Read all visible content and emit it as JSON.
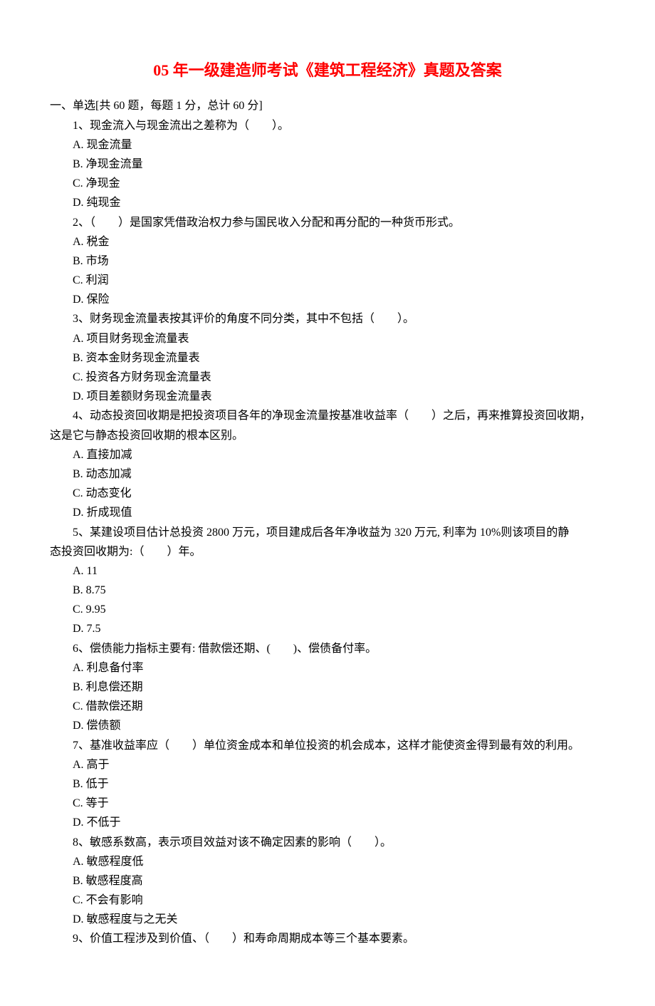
{
  "title": "05 年一级建造师考试《建筑工程经济》真题及答案",
  "section_header": "一、单选[共 60 题，每题 1 分，总计 60 分]",
  "questions": [
    {
      "text": "1、现金流入与现金流出之差称为（　　）。",
      "options": {
        "a": "A. 现金流量",
        "b": "B. 净现金流量",
        "c": "C. 净现金",
        "d": "D. 纯现金"
      }
    },
    {
      "text": "2、（　　）是国家凭借政治权力参与国民收入分配和再分配的一种货币形式。",
      "options": {
        "a": "A. 税金",
        "b": "B. 市场",
        "c": "C. 利润",
        "d": "D. 保险"
      }
    },
    {
      "text": "3、财务现金流量表按其评价的角度不同分类，其中不包括（　　）。",
      "options": {
        "a": "A. 项目财务现金流量表",
        "b": "B. 资本金财务现金流量表",
        "c": "C. 投资各方财务现金流量表",
        "d": "D. 项目差额财务现金流量表"
      }
    },
    {
      "text": "4、动态投资回收期是把投资项目各年的净现金流量按基准收益率（　　）之后，再来推算投资回收期，",
      "continuation": "这是它与静态投资回收期的根本区别。",
      "options": {
        "a": "A. 直接加减",
        "b": "B. 动态加减",
        "c": "C. 动态变化",
        "d": "D. 折成现值"
      }
    },
    {
      "text": "5、某建设项目估计总投资 2800 万元，项目建成后各年净收益为 320 万元, 利率为 10%则该项目的静",
      "continuation": "态投资回收期为:（　　）年。",
      "options": {
        "a": "A. 11",
        "b": "B. 8.75",
        "c": "C. 9.95",
        "d": "D. 7.5"
      }
    },
    {
      "text": "6、偿债能力指标主要有: 借款偿还期、(　　)、偿债备付率。",
      "options": {
        "a": "A. 利息备付率",
        "b": "B. 利息偿还期",
        "c": "C. 借款偿还期",
        "d": "D. 偿债额"
      }
    },
    {
      "text": "7、基准收益率应（　　）单位资金成本和单位投资的机会成本，这样才能使资金得到最有效的利用。",
      "options": {
        "a": "A. 高于",
        "b": "B. 低于",
        "c": "C. 等于",
        "d": "D. 不低于"
      }
    },
    {
      "text": "8、敏感系数高，表示项目效益对该不确定因素的影响（　　）。",
      "options": {
        "a": "A. 敏感程度低",
        "b": "B. 敏感程度高",
        "c": "C. 不会有影响",
        "d": "D. 敏感程度与之无关"
      }
    },
    {
      "text": "9、价值工程涉及到价值、（　　）和寿命周期成本等三个基本要素。"
    }
  ]
}
